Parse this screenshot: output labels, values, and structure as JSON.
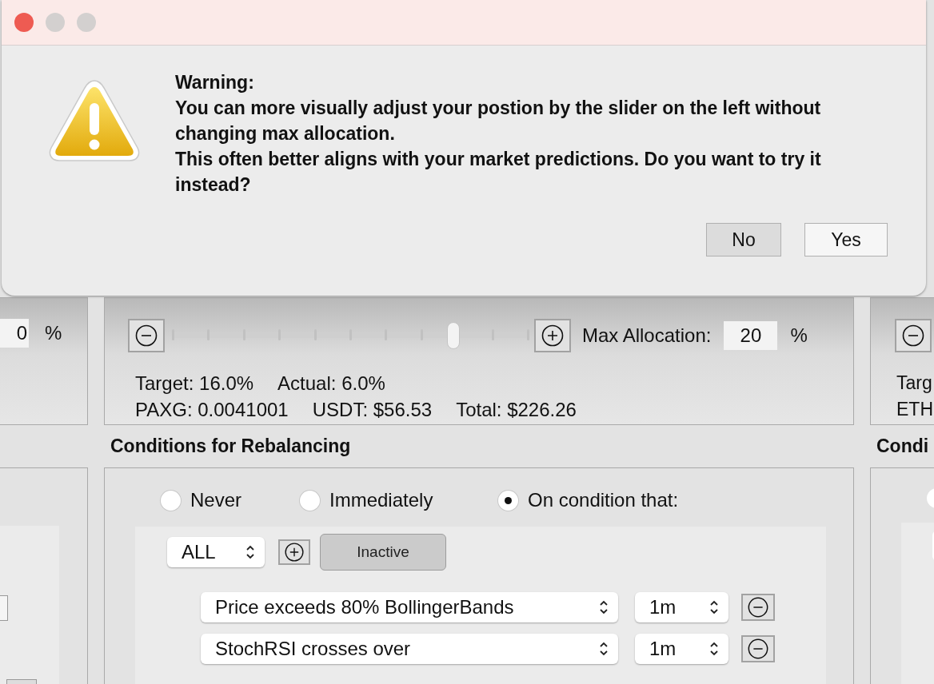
{
  "dialog": {
    "window_controls": [
      {
        "kind": "close"
      },
      {
        "kind": "minimize"
      },
      {
        "kind": "zoom"
      }
    ],
    "title": "Warning:",
    "paragraphs": [
      "You can more visually adjust your postion by the slider on the left without changing max allocation.",
      "This often better aligns with your market predictions. Do you want to try it instead?"
    ],
    "buttons": [
      {
        "label": "No"
      },
      {
        "label": "Yes"
      }
    ]
  },
  "left_column": {
    "percent_field": {
      "value": "0"
    },
    "percent_unit": "%"
  },
  "middle_column": {
    "allocation_slider": {
      "level": 0.79
    },
    "max_allocation": {
      "label": "Max Allocation:",
      "value": "20",
      "unit": "%"
    },
    "stats": [
      [
        "Target: 16.0%",
        "Actual: 6.0%"
      ],
      [
        "PAXG: 0.0041001",
        "USDT: $56.53",
        "Total: $226.26"
      ]
    ],
    "conditions_heading": "Conditions for Rebalancing",
    "rebalance_options": [
      {
        "label": "Never",
        "selected": false
      },
      {
        "label": "Immediately",
        "selected": false
      },
      {
        "label": "On condition that:",
        "selected": true
      }
    ],
    "match_select": "ALL",
    "status_button": "Inactive",
    "conditions": [
      {
        "indicator": "Price exceeds 80% BollingerBands",
        "interval": "1m"
      },
      {
        "indicator": "StochRSI crosses over",
        "interval": "1m"
      }
    ]
  },
  "right_column": {
    "stats": [
      "Targ",
      "ETH"
    ],
    "conditions_heading": "Condi"
  }
}
